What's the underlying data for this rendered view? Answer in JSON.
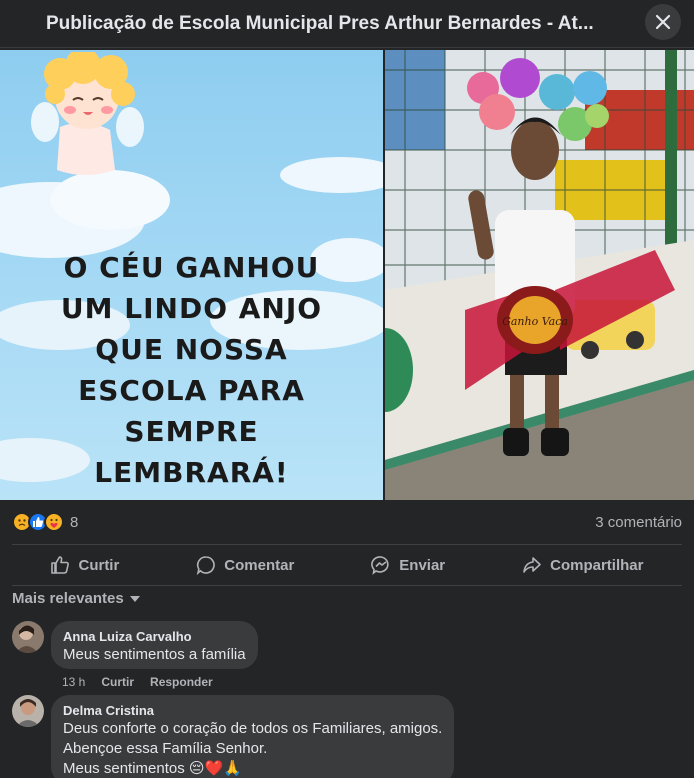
{
  "header": {
    "title": "Publicação de Escola Municipal Pres Arthur Bernardes - At..."
  },
  "poster": {
    "lines": [
      "O CÉU GANHOU",
      "UM LINDO ANJO",
      "QUE NOSSA",
      "ESCOLA PARA",
      "SEMPRE",
      "LEMBRARÁ!"
    ]
  },
  "photo": {
    "candy_label": "Ganho Vaca"
  },
  "reactions": {
    "icons": [
      "sad-icon",
      "like-icon",
      "care-icon"
    ],
    "count": "8",
    "comments": "3 comentário"
  },
  "actions": {
    "like": "Curtir",
    "comment": "Comentar",
    "send": "Enviar",
    "share": "Compartilhar"
  },
  "sort": {
    "label": "Mais relevantes"
  },
  "comments": [
    {
      "name": "Anna Luiza Carvalho",
      "text": "Meus sentimentos a família",
      "time": "13 h",
      "like": "Curtir",
      "reply": "Responder"
    },
    {
      "name": "Delma Cristina",
      "lines": [
        "Deus conforte o coração de todos os Familiares, amigos.",
        "Abençoe essa Família Senhor.",
        "Meus sentimentos 😔❤️🙏"
      ]
    }
  ],
  "colors": {
    "background": "#242526",
    "bubble": "#3a3b3c",
    "text": "#e4e6eb",
    "muted": "#b0b3b8",
    "like_blue": "#1877f2",
    "sad_yellow": "#f7b125"
  }
}
